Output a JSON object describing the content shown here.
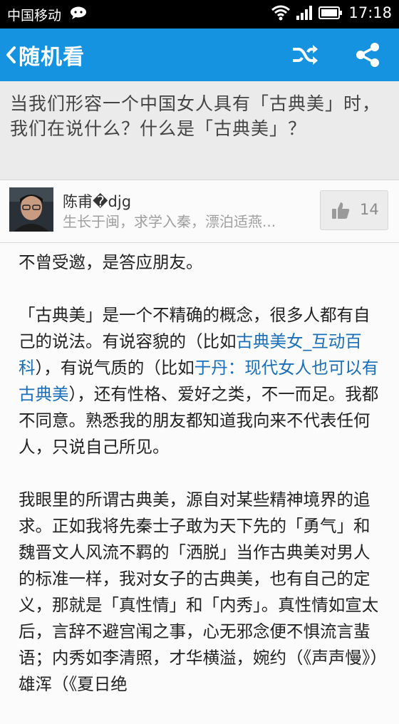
{
  "status_bar": {
    "carrier": "中国移动",
    "time": "17:18",
    "icons": [
      "message-icon",
      "wifi-icon",
      "signal-icon",
      "battery-icon"
    ]
  },
  "app_bar": {
    "title": "随机看",
    "color": "#1592e0",
    "icons": [
      "back-icon",
      "shuffle-icon",
      "share-icon"
    ]
  },
  "question": {
    "title": "当我们形容一个中国女人具有「古典美」时，我们在说什么？什么是「古典美」？"
  },
  "author": {
    "name": "陈甫�djg",
    "bio": "生长于闽，求学入秦，漂泊适燕...",
    "votes": "14"
  },
  "answer": {
    "p1": "不曾受邀，是答应朋友。",
    "p2": {
      "t1": "「古典美」是一个不精确的概念，很多人都有自己的说法。有说容貌的（比如",
      "link1": "古典美女_互动百科",
      "t2": "），有说气质的（比如",
      "link2": "于丹：现代女人也可以有古典美",
      "t3": "），还有性格、爱好之类，不一而足。我都不同意。熟悉我的朋友都知道我向来不代表任何人，只说自己所见。"
    },
    "p3": "我眼里的所谓古典美，源自对某些精神境界的追求。正如我将先秦士子敢为天下先的「勇气」和魏晋文人风流不羁的「洒脱」当作古典美对男人的标准一样，我对女子的古典美，也有自己的定义，那就是「真性情」和「内秀」。真性情如宣太后，言辞不避宫闱之事，心无邪念便不惧流言蜚语；内秀如李清照，才华横溢，婉约（《声声慢》）雄浑（《夏日绝",
    "link_color": "#1a6fb8"
  }
}
